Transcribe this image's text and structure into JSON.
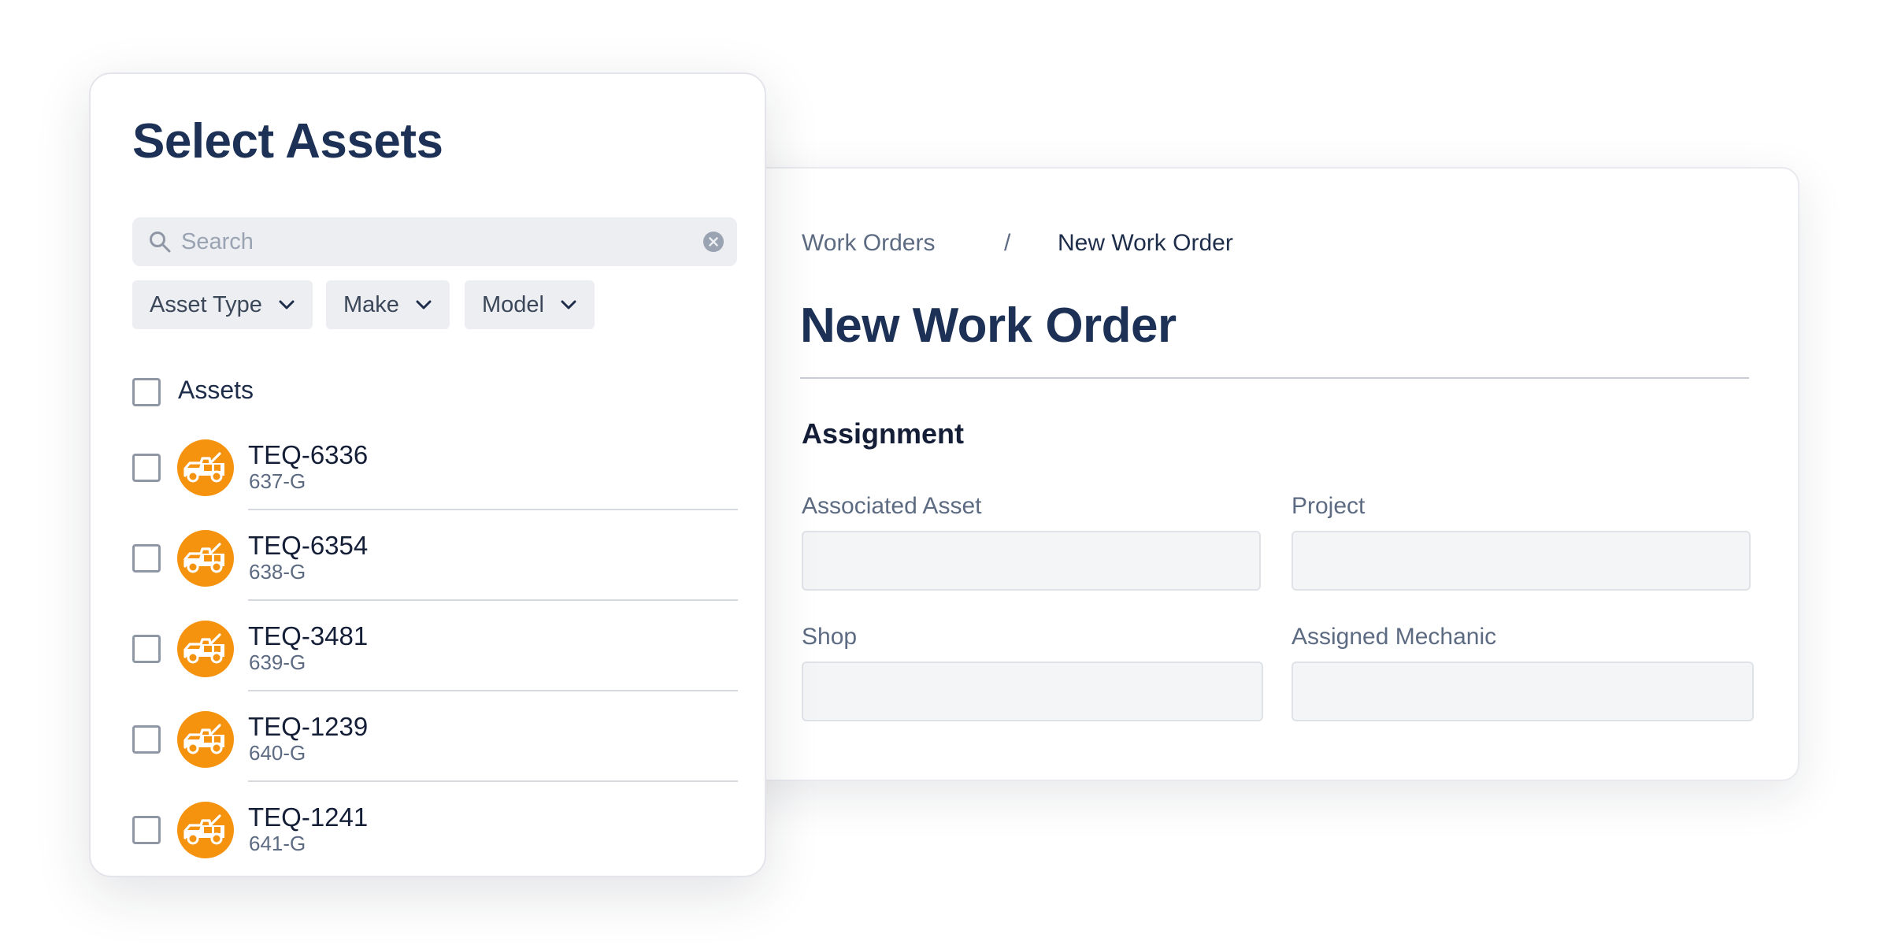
{
  "work_order": {
    "breadcrumb": {
      "parent": "Work Orders",
      "separator": "/",
      "current": "New Work Order"
    },
    "title": "New Work Order",
    "section_title": "Assignment",
    "fields": {
      "associated_asset": {
        "label": "Associated Asset",
        "value": ""
      },
      "project": {
        "label": "Project",
        "value": ""
      },
      "shop": {
        "label": "Shop",
        "value": ""
      },
      "assigned_mechanic": {
        "label": "Assigned Mechanic",
        "value": ""
      }
    }
  },
  "select_assets": {
    "title": "Select Assets",
    "search": {
      "placeholder": "Search",
      "value": ""
    },
    "filters": [
      "Asset Type",
      "Make",
      "Model"
    ],
    "select_all_label": "Assets",
    "assets": [
      {
        "name": "TEQ-6336",
        "code": "637-G",
        "icon": "tow-truck-icon"
      },
      {
        "name": "TEQ-6354",
        "code": "638-G",
        "icon": "tow-truck-icon"
      },
      {
        "name": "TEQ-3481",
        "code": "639-G",
        "icon": "tow-truck-icon"
      },
      {
        "name": "TEQ-1239",
        "code": "640-G",
        "icon": "tow-truck-icon"
      },
      {
        "name": "TEQ-1241",
        "code": "641-G",
        "icon": "tow-truck-icon"
      }
    ]
  },
  "colors": {
    "title": "#1c3155",
    "muted_text": "#5d6b82",
    "avatar_orange": "#f5920e",
    "input_fill": "#f4f5f7",
    "chip_fill": "#eceef2"
  }
}
